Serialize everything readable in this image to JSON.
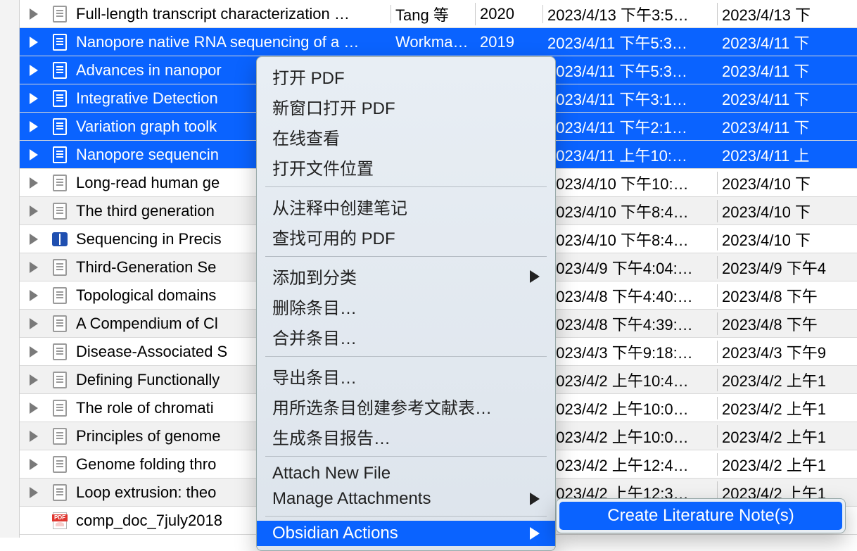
{
  "rows": [
    {
      "title": "Full-length transcript characterization …",
      "author": "Tang 等",
      "year": "2020",
      "d1": "2023/4/13 下午3:5…",
      "d2": "2023/4/13 下",
      "sel": false,
      "alt": false,
      "icon": "doc"
    },
    {
      "title": "Nanopore native RNA sequencing of a …",
      "author": "Workma…",
      "year": "2019",
      "d1": "2023/4/11 下午5:3…",
      "d2": "2023/4/11 下",
      "sel": true,
      "alt": true,
      "icon": "doc"
    },
    {
      "title": "Advances in nanopor",
      "author": "",
      "year": "",
      "d1": "2023/4/11 下午5:3…",
      "d2": "2023/4/11 下",
      "sel": true,
      "alt": false,
      "icon": "doc"
    },
    {
      "title": "Integrative Detection",
      "author": "",
      "year": "",
      "d1": "2023/4/11 下午3:1…",
      "d2": "2023/4/11 下",
      "sel": true,
      "alt": true,
      "icon": "doc"
    },
    {
      "title": "Variation graph toolk",
      "author": "",
      "year": "",
      "d1": "2023/4/11 下午2:1…",
      "d2": "2023/4/11 下",
      "sel": true,
      "alt": false,
      "icon": "doc"
    },
    {
      "title": "Nanopore sequencin",
      "author": "",
      "year": "",
      "d1": "2023/4/11 上午10:…",
      "d2": "2023/4/11 上",
      "sel": true,
      "alt": true,
      "icon": "doc"
    },
    {
      "title": "Long-read human ge",
      "author": "",
      "year": "",
      "d1": "2023/4/10 下午10:…",
      "d2": "2023/4/10 下",
      "sel": false,
      "alt": false,
      "icon": "doc"
    },
    {
      "title": "The third generation",
      "author": "",
      "year": "",
      "d1": "2023/4/10 下午8:4…",
      "d2": "2023/4/10 下",
      "sel": false,
      "alt": true,
      "icon": "doc"
    },
    {
      "title": "Sequencing in Precis",
      "author": "",
      "year": "",
      "d1": "2023/4/10 下午8:4…",
      "d2": "2023/4/10 下",
      "sel": false,
      "alt": false,
      "icon": "book"
    },
    {
      "title": "Third-Generation Se",
      "author": "",
      "year": "",
      "d1": "2023/4/9 下午4:04:…",
      "d2": "2023/4/9 下午4",
      "sel": false,
      "alt": true,
      "icon": "doc"
    },
    {
      "title": "Topological domains",
      "author": "",
      "year": "",
      "d1": "2023/4/8 下午4:40:…",
      "d2": "2023/4/8 下午",
      "sel": false,
      "alt": false,
      "icon": "doc"
    },
    {
      "title": "A Compendium of Cl",
      "author": "",
      "year": "",
      "d1": "2023/4/8 下午4:39:…",
      "d2": "2023/4/8 下午",
      "sel": false,
      "alt": true,
      "icon": "doc"
    },
    {
      "title": "Disease-Associated S",
      "author": "",
      "year": "",
      "d1": "2023/4/3 下午9:18:…",
      "d2": "2023/4/3 下午9",
      "sel": false,
      "alt": false,
      "icon": "doc"
    },
    {
      "title": "Defining Functionally",
      "author": "",
      "year": "",
      "d1": "2023/4/2 上午10:4…",
      "d2": "2023/4/2 上午1",
      "sel": false,
      "alt": true,
      "icon": "doc"
    },
    {
      "title": "The role of chromati",
      "author": "",
      "year": "",
      "d1": "2023/4/2 上午10:0…",
      "d2": "2023/4/2 上午1",
      "sel": false,
      "alt": false,
      "icon": "doc"
    },
    {
      "title": "Principles of genome",
      "author": "",
      "year": "",
      "d1": "2023/4/2 上午10:0…",
      "d2": "2023/4/2 上午1",
      "sel": false,
      "alt": true,
      "icon": "doc"
    },
    {
      "title": "Genome folding thro",
      "author": "",
      "year": "",
      "d1": "2023/4/2 上午12:4…",
      "d2": "2023/4/2 上午1",
      "sel": false,
      "alt": false,
      "icon": "doc"
    },
    {
      "title": "Loop extrusion: theo",
      "author": "",
      "year": "",
      "d1": "2023/4/2 上午12:3…",
      "d2": "2023/4/2 上午1",
      "sel": false,
      "alt": true,
      "icon": "doc"
    },
    {
      "title": "comp_doc_7july2018",
      "author": "",
      "year": "",
      "d1": "",
      "d2": "",
      "sel": false,
      "alt": false,
      "icon": "pdf",
      "noexp": true
    }
  ],
  "menu": {
    "open_pdf": "打开 PDF",
    "open_new_window": "新窗口打开 PDF",
    "view_online": "在线查看",
    "open_file_loc": "打开文件位置",
    "create_note": "从注释中创建笔记",
    "find_pdf": "查找可用的 PDF",
    "add_category": "添加到分类",
    "delete_item": "删除条目…",
    "merge_item": "合并条目…",
    "export_item": "导出条目…",
    "create_bib": "用所选条目创建参考文献表…",
    "gen_report": "生成条目报告…",
    "attach_new": "Attach New File",
    "manage_att": "Manage Attachments",
    "obsidian": "Obsidian Actions"
  },
  "submenu": {
    "create_lit_note": "Create Literature Note(s)"
  }
}
